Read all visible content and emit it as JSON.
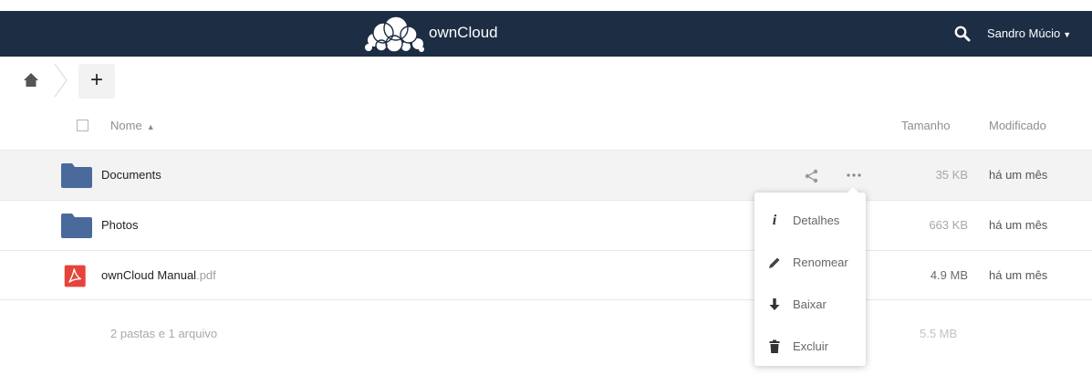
{
  "header": {
    "app_name": "ownCloud",
    "user_name": "Sandro Múcio",
    "background_color": "#1d2d44"
  },
  "toolbar": {
    "new_label": "+"
  },
  "table": {
    "columns": {
      "name": "Nome",
      "size": "Tamanho",
      "modified": "Modificado"
    },
    "rows": [
      {
        "name": "Documents",
        "ext": "",
        "type": "folder",
        "size": "35 KB",
        "size_color": "#a8a8a8",
        "modified": "há um mês"
      },
      {
        "name": "Photos",
        "ext": "",
        "type": "folder",
        "size": "663 KB",
        "size_color": "#a8a8a8",
        "modified": "há um mês"
      },
      {
        "name": "ownCloud Manual",
        "ext": ".pdf",
        "type": "pdf",
        "size": "4.9 MB",
        "size_color": "#6a6a6a",
        "modified": "há um mês"
      }
    ]
  },
  "summary": {
    "count": "2 pastas e 1 arquivo",
    "total_size": "5.5 MB"
  },
  "file_menu": {
    "items": [
      {
        "label": "Detalhes",
        "icon": "info-icon"
      },
      {
        "label": "Renomear",
        "icon": "pencil-icon"
      },
      {
        "label": "Baixar",
        "icon": "download-icon"
      },
      {
        "label": "Excluir",
        "icon": "trash-icon"
      }
    ]
  },
  "colors": {
    "folder": "#4a6a9c",
    "pdf": "#e6443a",
    "selected_row": "#f3f3f3"
  }
}
